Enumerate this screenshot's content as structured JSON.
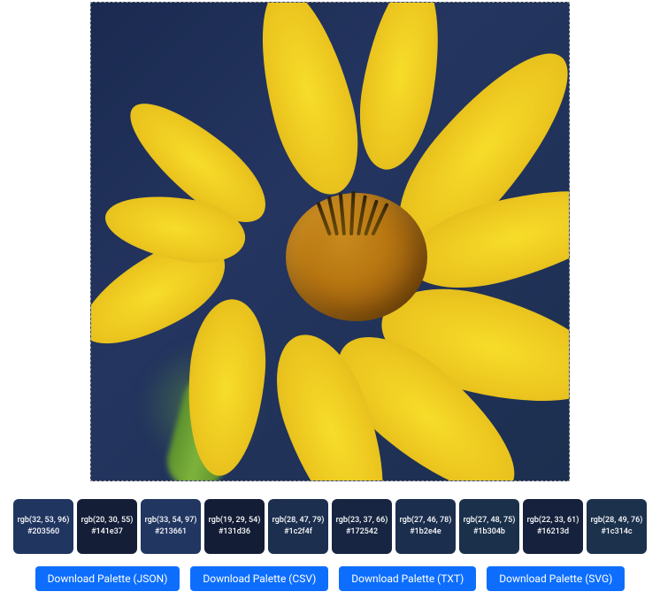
{
  "palette": [
    {
      "rgb": "rgb(32, 53, 96)",
      "hex": "#203560"
    },
    {
      "rgb": "rgb(20, 30, 55)",
      "hex": "#141e37"
    },
    {
      "rgb": "rgb(33, 54, 97)",
      "hex": "#213661"
    },
    {
      "rgb": "rgb(19, 29, 54)",
      "hex": "#131d36"
    },
    {
      "rgb": "rgb(28, 47, 79)",
      "hex": "#1c2f4f"
    },
    {
      "rgb": "rgb(23, 37, 66)",
      "hex": "#172542"
    },
    {
      "rgb": "rgb(27, 46, 78)",
      "hex": "#1b2e4e"
    },
    {
      "rgb": "rgb(27, 48, 75)",
      "hex": "#1b304b"
    },
    {
      "rgb": "rgb(22, 33, 61)",
      "hex": "#16213d"
    },
    {
      "rgb": "rgb(28, 49, 76)",
      "hex": "#1c314c"
    }
  ],
  "buttons": {
    "json": "Download Palette (JSON)",
    "csv": "Download Palette (CSV)",
    "txt": "Download Palette (TXT)",
    "svg": "Download Palette (SVG)"
  }
}
